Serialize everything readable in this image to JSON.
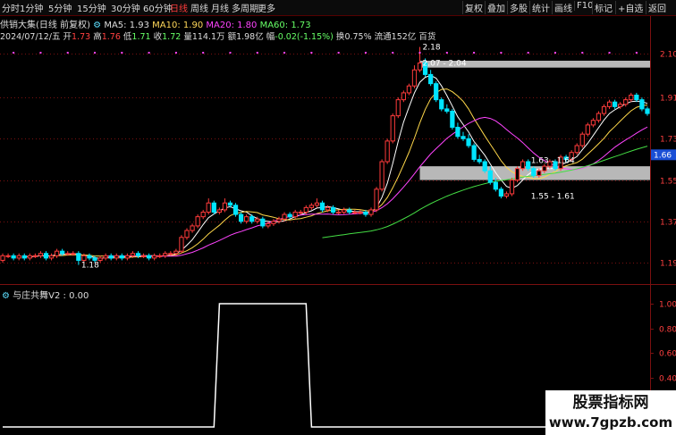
{
  "periods": [
    "分时",
    "1分钟",
    "5分钟",
    "15分钟",
    "30分钟",
    "60分钟",
    "日线",
    "周线",
    "月线",
    "多周期",
    "更多"
  ],
  "active_period": "日线",
  "tools": [
    "复权",
    "叠加",
    "多股",
    "统计",
    "画线",
    "F10",
    "标记",
    "+自选",
    "返回"
  ],
  "info": {
    "name": "供销大集(日线 前复权)",
    "ma5": "MA5: 1.93",
    "ma10": "MA10: 1.90",
    "ma20": "MA20: 1.80",
    "ma60": "MA60: 1.73",
    "date": "2024/07/12/五",
    "open_l": "开",
    "open": "1.73",
    "high_l": "高",
    "high": "1.76",
    "low_l": "低",
    "low": "1.71",
    "close_l": "收",
    "close": "1.72",
    "vol_l": "量",
    "vol": "114.1万",
    "amt_l": "额",
    "amt": "1.98亿",
    "chg_l": "幅",
    "chg": "-0.02(-1.15%)",
    "turn_l": "换",
    "turn": "0.75%",
    "float_l": "流通",
    "float": "152亿",
    "extra": "百货"
  },
  "indicator": {
    "title": "与庄共舞V2 : 0.00"
  },
  "watermark": {
    "line1": "股票指标网",
    "line2": "www.7gpzb.com"
  },
  "colors": {
    "up": "#ff3b3b",
    "down": "#00e5ff",
    "ma5": "#ffffff",
    "ma10": "#ffd84a",
    "ma20": "#ff44ff",
    "ma60": "#44dd44",
    "indicator": "#ffffff",
    "signal": "#ff44ff",
    "grid": "#7a1010"
  },
  "chart_data": [
    {
      "type": "candlestick",
      "ylim": [
        1.12,
        2.14
      ],
      "yticks": [
        2.1,
        1.91,
        1.73,
        1.55,
        1.37,
        1.19
      ],
      "current_price": "1.66",
      "x": [
        0,
        1,
        2,
        3,
        4,
        5,
        6,
        7,
        8,
        9,
        10,
        11,
        12,
        13,
        14,
        15,
        16,
        17,
        18,
        19,
        20,
        21,
        22,
        23,
        24,
        25,
        26,
        27,
        28,
        29,
        30,
        31,
        32,
        33,
        34,
        35,
        36,
        37,
        38,
        39,
        40,
        41,
        42,
        43,
        44,
        45,
        46,
        47,
        48,
        49,
        50,
        51,
        52,
        53,
        54,
        55,
        56,
        57,
        58,
        59,
        60,
        61,
        62,
        63,
        64,
        65,
        66,
        67,
        68,
        69,
        70,
        71,
        72,
        73,
        74,
        75,
        76,
        77,
        78,
        79,
        80,
        81,
        82,
        83,
        84,
        85,
        86,
        87,
        88,
        89,
        90,
        91,
        92,
        93,
        94,
        95,
        96,
        97,
        98,
        99,
        100,
        101,
        102,
        103,
        104,
        105,
        106,
        107,
        108,
        109,
        110,
        111,
        112,
        113,
        114,
        115,
        116,
        117,
        118,
        119
      ],
      "open": [
        1.2,
        1.22,
        1.22,
        1.21,
        1.22,
        1.21,
        1.22,
        1.22,
        1.23,
        1.21,
        1.22,
        1.24,
        1.23,
        1.23,
        1.23,
        1.2,
        1.22,
        1.21,
        1.2,
        1.21,
        1.22,
        1.21,
        1.22,
        1.21,
        1.22,
        1.23,
        1.22,
        1.22,
        1.21,
        1.22,
        1.22,
        1.23,
        1.23,
        1.24,
        1.3,
        1.33,
        1.35,
        1.39,
        1.41,
        1.45,
        1.41,
        1.42,
        1.45,
        1.44,
        1.4,
        1.37,
        1.39,
        1.37,
        1.38,
        1.35,
        1.36,
        1.37,
        1.38,
        1.4,
        1.39,
        1.41,
        1.41,
        1.43,
        1.44,
        1.45,
        1.42,
        1.43,
        1.41,
        1.41,
        1.42,
        1.41,
        1.41,
        1.41,
        1.4,
        1.42,
        1.51,
        1.63,
        1.72,
        1.83,
        1.9,
        1.93,
        1.96,
        2.03,
        2.06,
        2.01,
        1.97,
        1.9,
        1.86,
        1.85,
        1.78,
        1.74,
        1.73,
        1.7,
        1.64,
        1.63,
        1.59,
        1.54,
        1.51,
        1.48,
        1.49,
        1.55,
        1.6,
        1.63,
        1.6,
        1.57,
        1.59,
        1.61,
        1.63,
        1.6,
        1.65,
        1.64,
        1.67,
        1.7,
        1.75,
        1.79,
        1.81,
        1.84,
        1.87,
        1.89,
        1.87,
        1.88,
        1.9,
        1.92,
        1.9,
        1.86
      ],
      "close": [
        1.22,
        1.22,
        1.21,
        1.22,
        1.21,
        1.22,
        1.22,
        1.23,
        1.21,
        1.22,
        1.24,
        1.23,
        1.23,
        1.23,
        1.2,
        1.22,
        1.21,
        1.2,
        1.21,
        1.22,
        1.21,
        1.22,
        1.21,
        1.22,
        1.23,
        1.22,
        1.22,
        1.21,
        1.22,
        1.22,
        1.23,
        1.23,
        1.24,
        1.3,
        1.33,
        1.35,
        1.39,
        1.41,
        1.45,
        1.41,
        1.42,
        1.45,
        1.44,
        1.4,
        1.37,
        1.39,
        1.37,
        1.38,
        1.35,
        1.36,
        1.37,
        1.38,
        1.4,
        1.39,
        1.41,
        1.41,
        1.43,
        1.44,
        1.45,
        1.42,
        1.43,
        1.41,
        1.41,
        1.42,
        1.41,
        1.41,
        1.41,
        1.4,
        1.42,
        1.51,
        1.63,
        1.72,
        1.83,
        1.9,
        1.93,
        1.96,
        2.03,
        2.06,
        2.01,
        1.97,
        1.9,
        1.86,
        1.85,
        1.78,
        1.74,
        1.73,
        1.7,
        1.64,
        1.63,
        1.59,
        1.54,
        1.51,
        1.48,
        1.49,
        1.55,
        1.6,
        1.63,
        1.6,
        1.57,
        1.59,
        1.61,
        1.63,
        1.6,
        1.65,
        1.64,
        1.67,
        1.7,
        1.75,
        1.79,
        1.81,
        1.84,
        1.87,
        1.89,
        1.87,
        1.88,
        1.9,
        1.92,
        1.9,
        1.86,
        1.84
      ],
      "high": [
        1.23,
        1.23,
        1.23,
        1.23,
        1.23,
        1.23,
        1.23,
        1.24,
        1.24,
        1.23,
        1.25,
        1.25,
        1.24,
        1.24,
        1.24,
        1.23,
        1.23,
        1.22,
        1.22,
        1.23,
        1.23,
        1.23,
        1.23,
        1.23,
        1.24,
        1.24,
        1.23,
        1.23,
        1.23,
        1.23,
        1.24,
        1.24,
        1.25,
        1.31,
        1.34,
        1.36,
        1.4,
        1.42,
        1.47,
        1.46,
        1.43,
        1.47,
        1.46,
        1.45,
        1.41,
        1.4,
        1.4,
        1.39,
        1.39,
        1.37,
        1.38,
        1.39,
        1.41,
        1.41,
        1.42,
        1.42,
        1.44,
        1.45,
        1.47,
        1.46,
        1.44,
        1.44,
        1.42,
        1.43,
        1.43,
        1.42,
        1.42,
        1.42,
        1.43,
        1.52,
        1.64,
        1.73,
        1.84,
        1.91,
        1.94,
        1.97,
        2.05,
        2.13,
        2.08,
        2.03,
        1.98,
        1.91,
        1.88,
        1.86,
        1.8,
        1.76,
        1.75,
        1.71,
        1.66,
        1.64,
        1.61,
        1.56,
        1.52,
        1.5,
        1.56,
        1.61,
        1.64,
        1.64,
        1.61,
        1.6,
        1.62,
        1.64,
        1.64,
        1.66,
        1.66,
        1.68,
        1.71,
        1.76,
        1.8,
        1.82,
        1.85,
        1.88,
        1.9,
        1.9,
        1.89,
        1.91,
        1.93,
        1.93,
        1.91,
        1.87
      ],
      "low": [
        1.19,
        1.21,
        1.2,
        1.2,
        1.2,
        1.2,
        1.21,
        1.21,
        1.2,
        1.2,
        1.21,
        1.22,
        1.22,
        1.22,
        1.18,
        1.19,
        1.2,
        1.19,
        1.19,
        1.2,
        1.2,
        1.2,
        1.2,
        1.2,
        1.21,
        1.21,
        1.21,
        1.2,
        1.2,
        1.21,
        1.21,
        1.22,
        1.22,
        1.23,
        1.29,
        1.32,
        1.34,
        1.38,
        1.4,
        1.4,
        1.4,
        1.41,
        1.43,
        1.39,
        1.36,
        1.36,
        1.36,
        1.36,
        1.34,
        1.34,
        1.35,
        1.36,
        1.37,
        1.38,
        1.38,
        1.4,
        1.4,
        1.42,
        1.43,
        1.41,
        1.41,
        1.4,
        1.4,
        1.4,
        1.4,
        1.4,
        1.4,
        1.39,
        1.39,
        1.41,
        1.5,
        1.62,
        1.71,
        1.82,
        1.89,
        1.92,
        1.95,
        2.02,
        2.0,
        1.96,
        1.89,
        1.85,
        1.84,
        1.77,
        1.73,
        1.72,
        1.69,
        1.63,
        1.62,
        1.58,
        1.53,
        1.5,
        1.47,
        1.47,
        1.48,
        1.54,
        1.59,
        1.59,
        1.56,
        1.56,
        1.58,
        1.6,
        1.59,
        1.59,
        1.63,
        1.63,
        1.66,
        1.69,
        1.74,
        1.78,
        1.8,
        1.83,
        1.86,
        1.86,
        1.86,
        1.87,
        1.89,
        1.89,
        1.85,
        1.83
      ],
      "annotations": [
        {
          "label": "2.18",
          "x": 77,
          "y": 2.13
        },
        {
          "label": "2.07 - 2.04",
          "x": 77,
          "y": 2.06
        },
        {
          "label": "1.63 - 1.64",
          "x": 97,
          "y": 1.635
        },
        {
          "label": "1.55 - 1.61",
          "x": 97,
          "y": 1.48
        },
        {
          "label": "1.18",
          "x": 14,
          "y": 1.18
        }
      ],
      "zones": [
        {
          "from": 2.04,
          "to": 2.07
        },
        {
          "from": 1.55,
          "to": 1.61
        }
      ]
    },
    {
      "type": "line",
      "title": "与庄共舞V2 : 0.00",
      "ylim": [
        0,
        1
      ],
      "yticks": [
        "1.00",
        "0.80",
        "0.60",
        "0.40",
        "0.20",
        "0.00"
      ],
      "x": [
        0,
        39,
        40,
        56,
        57,
        119
      ],
      "values": [
        0,
        0,
        1,
        1,
        0,
        0
      ]
    }
  ]
}
